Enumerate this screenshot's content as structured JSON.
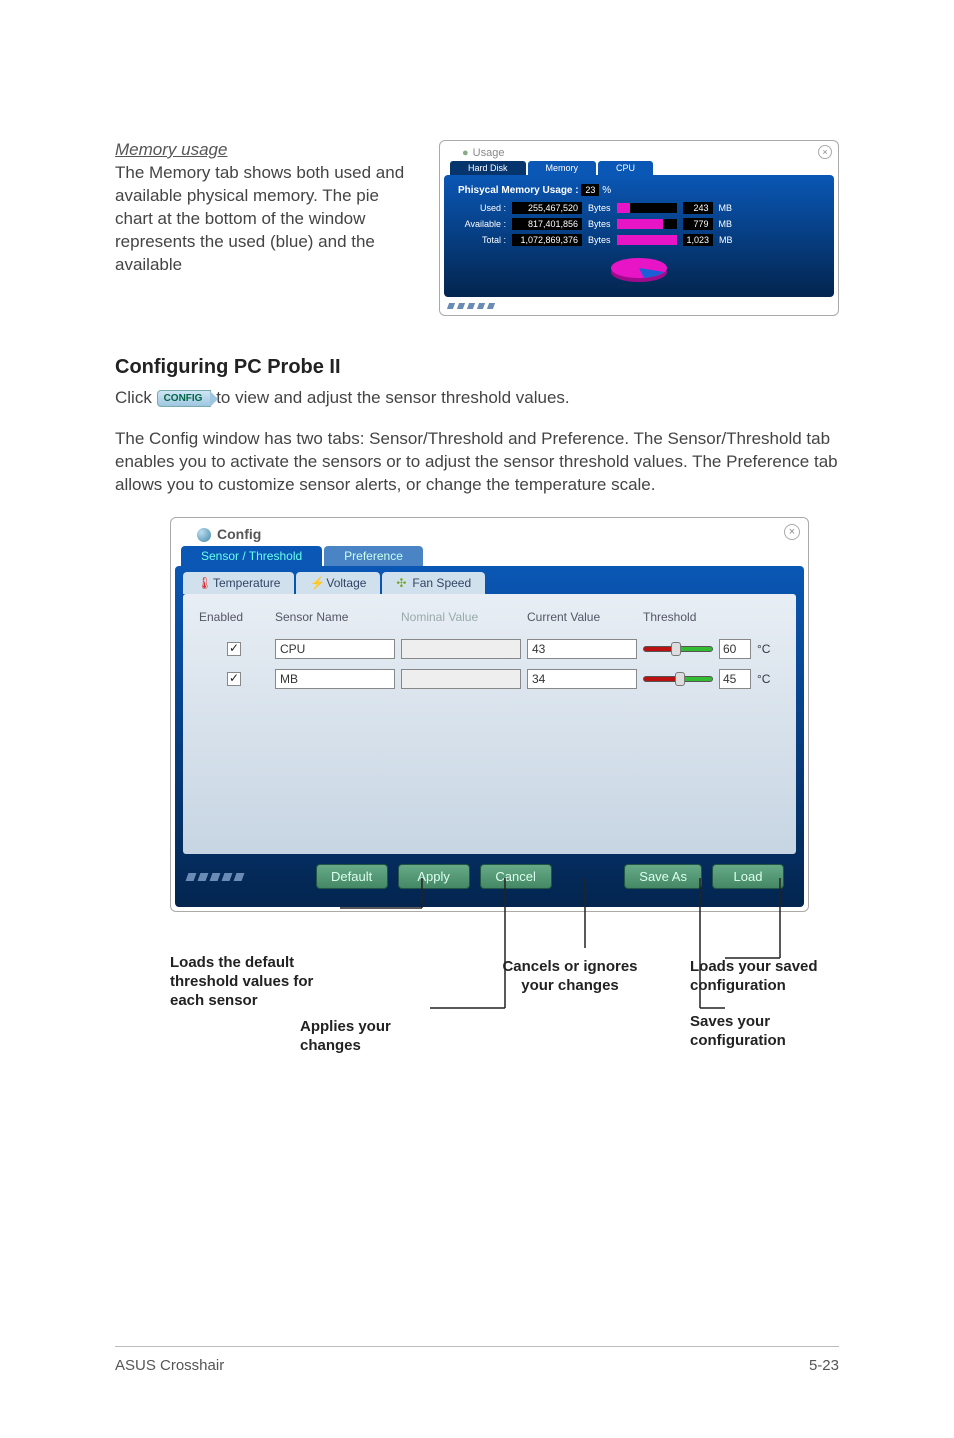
{
  "memory_section": {
    "heading": "Memory usage",
    "body": "The Memory tab shows both used and available physical memory. The pie chart at the bottom of the window represents the used (blue) and the available"
  },
  "usage_window": {
    "title": "Usage",
    "tabs": {
      "hard_disk": "Hard Disk",
      "memory": "Memory",
      "cpu": "CPU"
    },
    "physical_label": "Phisycal Memory Usage :",
    "physical_pct": "23",
    "pct_unit": "%",
    "rows": [
      {
        "label": "Used :",
        "bytes": "255,467,520",
        "bytes_unit": "Bytes",
        "fill_pct": 23,
        "mb": "243",
        "mb_unit": "MB"
      },
      {
        "label": "Available :",
        "bytes": "817,401,856",
        "bytes_unit": "Bytes",
        "fill_pct": 77,
        "mb": "779",
        "mb_unit": "MB"
      },
      {
        "label": "Total :",
        "bytes": "1,072,869,376",
        "bytes_unit": "Bytes",
        "fill_pct": 100,
        "mb": "1,023",
        "mb_unit": "MB"
      }
    ]
  },
  "config_section": {
    "heading": "Configuring PC Probe II",
    "click_pre": "Click ",
    "config_btn": "CONFIG",
    "click_post": " to view and adjust the sensor threshold values.",
    "para2": "The Config window has two tabs: Sensor/Threshold and Preference. The Sensor/Threshold tab enables you to activate the sensors or to adjust the sensor threshold values. The Preference tab allows you to customize sensor alerts, or change the temperature scale."
  },
  "config_window": {
    "title": "Config",
    "outer_tabs": {
      "sensor": "Sensor / Threshold",
      "preference": "Preference"
    },
    "sub_tabs": {
      "temp": "Temperature",
      "volt": "Voltage",
      "fan": "Fan Speed"
    },
    "columns": {
      "enabled": "Enabled",
      "sensor_name": "Sensor Name",
      "nominal": "Nominal Value",
      "current": "Current Value",
      "threshold": "Threshold"
    },
    "rows": [
      {
        "enabled": true,
        "name": "CPU",
        "nominal": "",
        "current": "43",
        "threshold": "60",
        "thumb_pct": 40,
        "unit": "°C"
      },
      {
        "enabled": true,
        "name": "MB",
        "nominal": "",
        "current": "34",
        "threshold": "45",
        "thumb_pct": 45,
        "unit": "°C"
      }
    ],
    "buttons": {
      "default": "Default",
      "apply": "Apply",
      "cancel": "Cancel",
      "save_as": "Save As",
      "load": "Load"
    }
  },
  "callouts": {
    "default": "Loads the default threshold values for each sensor",
    "apply": "Applies your changes",
    "cancel": "Cancels or ignores your changes",
    "load": "Loads your saved configuration",
    "save": "Saves your configuration"
  },
  "footer": {
    "left": "ASUS Crosshair",
    "right": "5-23"
  }
}
